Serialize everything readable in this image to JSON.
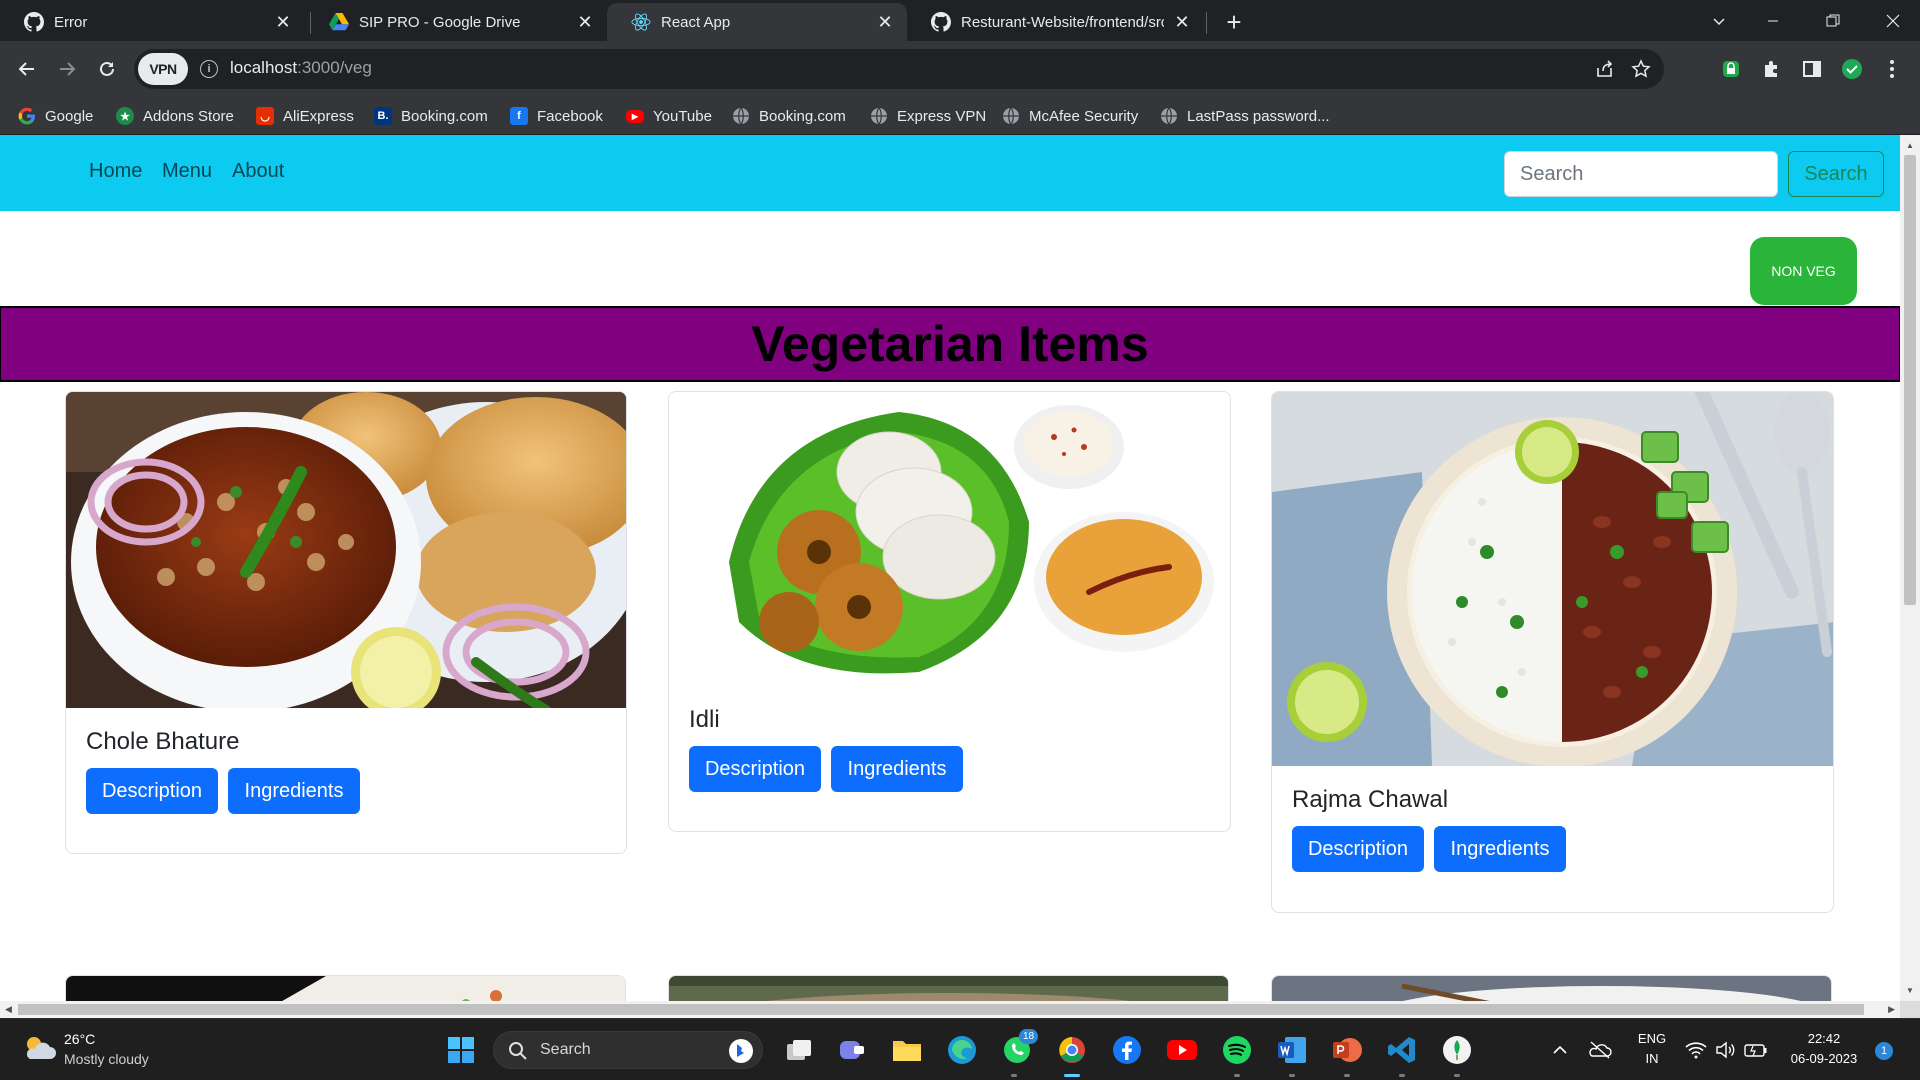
{
  "browser": {
    "tabs": [
      {
        "title": "Error",
        "favicon": "github-icon",
        "active": false
      },
      {
        "title": "SIP PRO - Google Drive",
        "favicon": "google-drive-icon",
        "active": false
      },
      {
        "title": "React App",
        "favicon": "react-icon",
        "active": true
      },
      {
        "title": "Resturant-Website/frontend/src/",
        "favicon": "github-icon",
        "active": false
      }
    ],
    "vpn_label": "VPN",
    "url_host": "localhost",
    "url_path": ":3000/veg",
    "bookmarks": [
      {
        "label": "Google",
        "icon": "google-icon"
      },
      {
        "label": "Addons Store",
        "icon": "addons-store-icon"
      },
      {
        "label": "AliExpress",
        "icon": "aliexpress-icon"
      },
      {
        "label": "Booking.com",
        "icon": "booking-icon"
      },
      {
        "label": "Facebook",
        "icon": "facebook-icon"
      },
      {
        "label": "YouTube",
        "icon": "youtube-icon"
      },
      {
        "label": "Booking.com",
        "icon": "globe-icon"
      },
      {
        "label": "Express VPN",
        "icon": "globe-icon"
      },
      {
        "label": "McAfee Security",
        "icon": "globe-icon"
      },
      {
        "label": "LastPass password...",
        "icon": "globe-icon"
      }
    ]
  },
  "app": {
    "nav_links": [
      "Home",
      "Menu",
      "About"
    ],
    "search_placeholder": "Search",
    "search_button": "Search",
    "nonveg_button": "NON VEG",
    "heading": "Vegetarian Items",
    "cards": [
      {
        "title": "Chole Bhature",
        "description_label": "Description",
        "ingredients_label": "Ingredients"
      },
      {
        "title": "Idli",
        "description_label": "Description",
        "ingredients_label": "Ingredients"
      },
      {
        "title": "Rajma Chawal",
        "description_label": "Description",
        "ingredients_label": "Ingredients"
      }
    ],
    "colors": {
      "navbar": "#0dcaf0",
      "banner": "#800080",
      "nonveg": "#2ab53a",
      "button": "#0d6efd"
    }
  },
  "taskbar": {
    "temperature": "26°C",
    "condition": "Mostly cloudy",
    "search_label": "Search",
    "whatsapp_badge": "18",
    "language": "ENG",
    "region": "IN",
    "time": "22:42",
    "date": "06-09-2023",
    "notification_count": "1"
  }
}
